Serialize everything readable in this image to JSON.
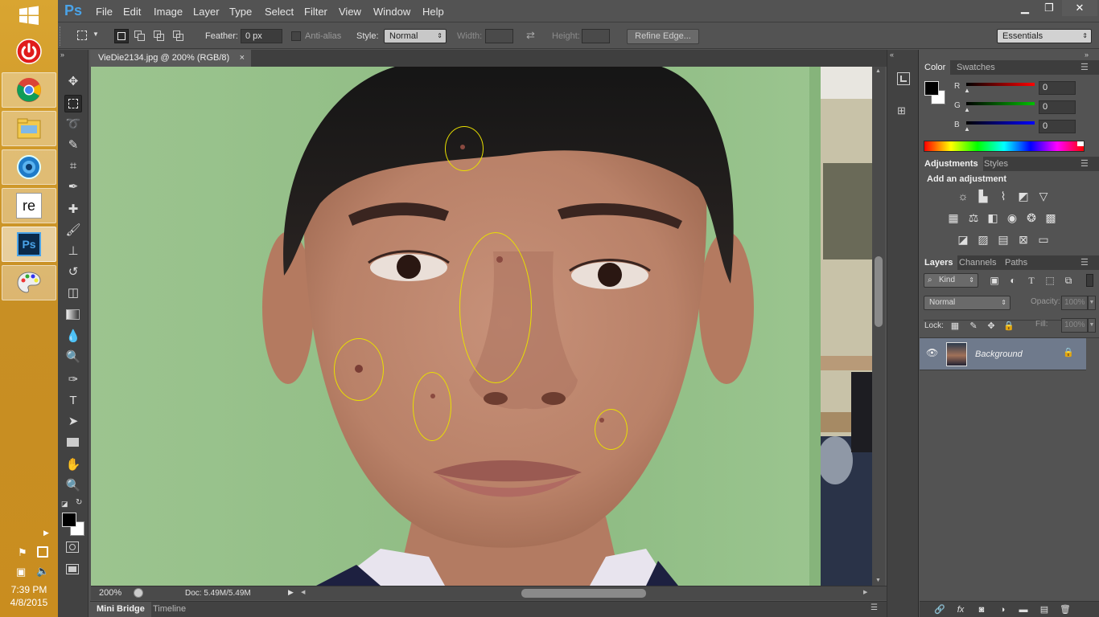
{
  "taskbar": {
    "apps": [
      {
        "name": "power",
        "icon": "power-icon"
      },
      {
        "name": "chrome",
        "icon": "chrome-icon"
      },
      {
        "name": "file-explorer",
        "icon": "folder-icon"
      },
      {
        "name": "ie",
        "icon": "globe-icon"
      },
      {
        "name": "re",
        "label": "re",
        "icon": "re-icon"
      },
      {
        "name": "photoshop",
        "label": "Ps",
        "icon": "photoshop-icon"
      },
      {
        "name": "paint",
        "icon": "palette-icon"
      }
    ],
    "time": "7:39 PM",
    "date": "4/8/2015"
  },
  "menubar": {
    "logo": "Ps",
    "items": [
      "File",
      "Edit",
      "Image",
      "Layer",
      "Type",
      "Select",
      "Filter",
      "View",
      "Window",
      "Help"
    ]
  },
  "options": {
    "feather_label": "Feather:",
    "feather_value": "0 px",
    "antialias_label": "Anti-alias",
    "style_label": "Style:",
    "style_value": "Normal",
    "width_label": "Width:",
    "height_label": "Height:",
    "refine_label": "Refine Edge...",
    "workspace": "Essentials"
  },
  "document": {
    "tab_title": "VieDie2134.jpg @ 200% (RGB/8)",
    "close": "×",
    "zoom": "200%",
    "doc_size": "Doc: 5.49M/5.49M"
  },
  "bottom_tabs": [
    "Mini Bridge",
    "Timeline"
  ],
  "color_panel": {
    "tabs": [
      "Color",
      "Swatches"
    ],
    "channels": [
      {
        "label": "R",
        "value": "0",
        "color": "#ff0000"
      },
      {
        "label": "G",
        "value": "0",
        "color": "#00b400"
      },
      {
        "label": "B",
        "value": "0",
        "color": "#0000ff"
      }
    ]
  },
  "adjustments_panel": {
    "tabs": [
      "Adjustments",
      "Styles"
    ],
    "heading": "Add an adjustment"
  },
  "layers_panel": {
    "tabs": [
      "Layers",
      "Channels",
      "Paths"
    ],
    "filter_kind": "Kind",
    "blend_mode": "Normal",
    "opacity_label": "Opacity:",
    "opacity_value": "100%",
    "lock_label": "Lock:",
    "fill_label": "Fill:",
    "fill_value": "100%",
    "layers": [
      {
        "name": "Background"
      }
    ]
  },
  "colors": {
    "accent": "#4aa3e8",
    "selection_ellipse": "#e9e000",
    "panel_bg": "#535353"
  }
}
